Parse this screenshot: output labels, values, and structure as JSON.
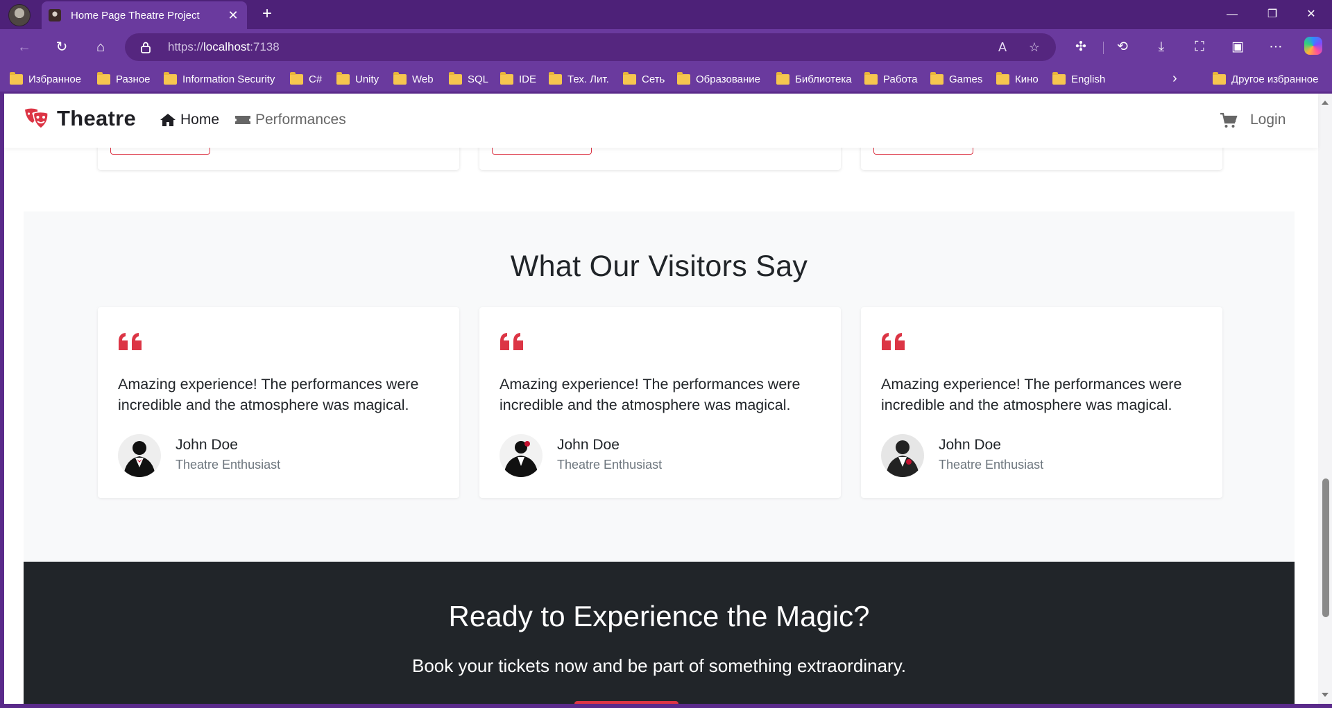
{
  "browser": {
    "tab_title": "Home Page Theatre Project",
    "url_scheme": "https://",
    "url_host": "localhost",
    "url_rest": ":7138",
    "bookmarks": [
      "Избранное",
      "Разное",
      "Information Security",
      "C#",
      "Unity",
      "Web",
      "SQL",
      "IDE",
      "Тех. Лит.",
      "Сеть",
      "Образование",
      "Библиотека",
      "Работа",
      "Games",
      "Кино",
      "English"
    ],
    "other_bookmarks": "Другое избранное",
    "accent": "#6a3a9e"
  },
  "site": {
    "brand": "Theatre",
    "nav_home": "Home",
    "nav_performances": "Performances",
    "login": "Login",
    "brand_color": "#dc3545"
  },
  "testimonials": {
    "title": "What Our Visitors Say",
    "items": [
      {
        "quote": "Amazing experience! The performances were incredible and the atmosphere was magical.",
        "name": "John Doe",
        "role": "Theatre Enthusiast"
      },
      {
        "quote": "Amazing experience! The performances were incredible and the atmosphere was magical.",
        "name": "John Doe",
        "role": "Theatre Enthusiast"
      },
      {
        "quote": "Amazing experience! The performances were incredible and the atmosphere was magical.",
        "name": "John Doe",
        "role": "Theatre Enthusiast"
      }
    ]
  },
  "cta": {
    "title": "Ready to Experience the Magic?",
    "subtitle": "Book your tickets now and be part of something extraordinary."
  }
}
